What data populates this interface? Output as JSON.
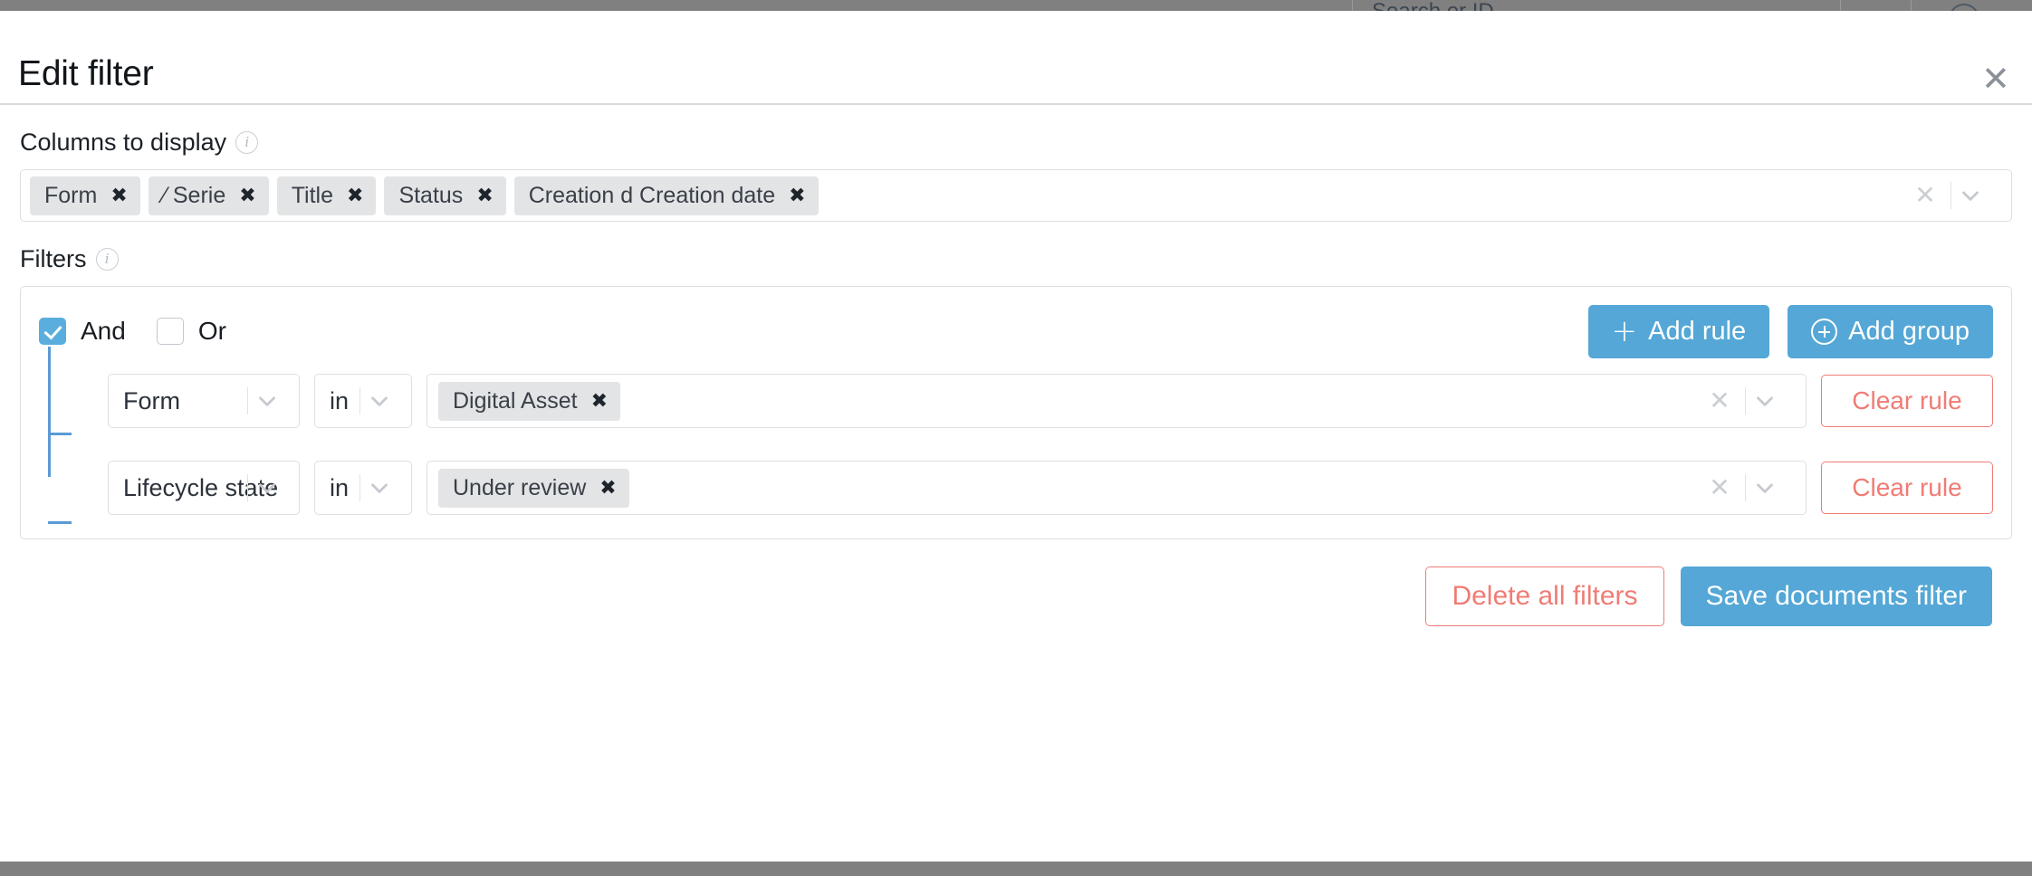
{
  "background": {
    "search_placeholder": "Search or ID",
    "chevron_icon": "chevron-down-icon",
    "help_icon": "?",
    "user_icon": "⌂"
  },
  "modal": {
    "title": "Edit filter",
    "close_label": "✕"
  },
  "columns_section": {
    "label": "Columns to display",
    "info_icon": "i",
    "tags": [
      {
        "label": "Form",
        "remove": "✖"
      },
      {
        "label": "⁄ Serie",
        "remove": "✖"
      },
      {
        "label": "Title",
        "remove": "✖"
      },
      {
        "label": "Status",
        "remove": "✖"
      },
      {
        "label": "Creation d Creation date",
        "remove": "✖"
      }
    ],
    "clear_all": "✕",
    "caret_icon": "chevron-down-icon"
  },
  "filters_section": {
    "label": "Filters",
    "info_icon": "i",
    "group": {
      "and_label": "And",
      "and_checked": true,
      "or_label": "Or",
      "or_checked": false,
      "add_rule_label": "Add rule",
      "add_rule_icon": "+",
      "add_group_label": "Add group",
      "add_group_icon": "⊕",
      "rules": [
        {
          "field": "Form",
          "operator": "in",
          "values": [
            {
              "label": "Digital Asset",
              "remove": "✖"
            }
          ],
          "clear_label": "Clear rule",
          "clear_value_icon": "✕"
        },
        {
          "field": "Lifecycle state",
          "operator": "in",
          "values": [
            {
              "label": "Under review",
              "remove": "✖"
            }
          ],
          "clear_label": "Clear rule",
          "clear_value_icon": "✕"
        }
      ]
    }
  },
  "footer": {
    "delete_label": "Delete all filters",
    "save_label": "Save documents filter"
  },
  "colors": {
    "accent_blue": "#54a7d6",
    "danger_red": "#ef7c75",
    "tag_grey": "#e3e4e6",
    "border_grey": "#dcdfe3",
    "chrome_grey": "#808080"
  }
}
